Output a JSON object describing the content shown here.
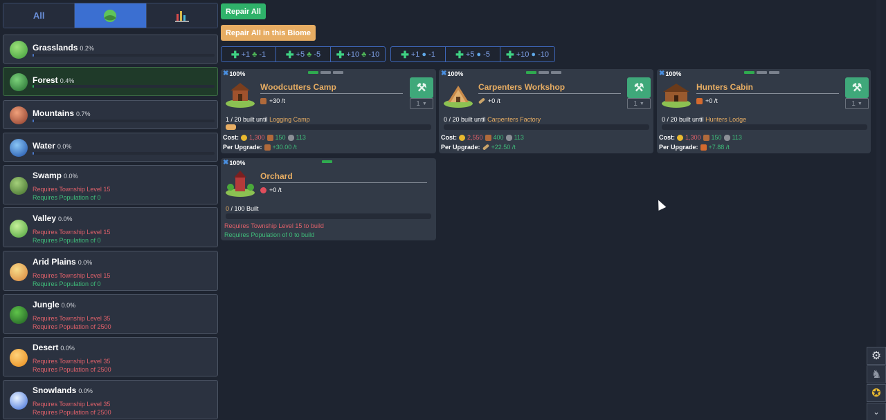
{
  "tabs": [
    {
      "label": "All"
    },
    {
      "label": "",
      "icon": "globe-icon"
    },
    {
      "label": "",
      "icon": "stats-chart-icon"
    }
  ],
  "biomes": [
    {
      "name": "Grasslands",
      "pct": "0.2%",
      "icon_color": "#5fc45a"
    },
    {
      "name": "Forest",
      "pct": "0.4%",
      "icon_color": "#3a9a45"
    },
    {
      "name": "Mountains",
      "pct": "0.7%",
      "icon_color": "#c86a4a"
    },
    {
      "name": "Water",
      "pct": "0.0%",
      "icon_color": "#3a7ad8"
    },
    {
      "name": "Swamp",
      "pct": "0.0%",
      "req_level": "Requires Township Level 15",
      "req_pop": "Requires Population of 0"
    },
    {
      "name": "Valley",
      "pct": "0.0%",
      "req_level": "Requires Township Level 15",
      "req_pop": "Requires Population of 0"
    },
    {
      "name": "Arid Plains",
      "pct": "0.0%",
      "req_level": "Requires Township Level 15",
      "req_pop": "Requires Population of 0"
    },
    {
      "name": "Jungle",
      "pct": "0.0%",
      "req_level": "Requires Township Level 35",
      "req_pop": "Requires Population of 2500"
    },
    {
      "name": "Desert",
      "pct": "0.0%",
      "req_level": "Requires Township Level 35",
      "req_pop": "Requires Population of 2500"
    },
    {
      "name": "Snowlands",
      "pct": "0.0%",
      "req_level": "Requires Township Level 35",
      "req_pop": "Requires Population of 2500"
    }
  ],
  "actions": {
    "repair_all": "Repair All",
    "repair_biome": "Repair All in this Biome"
  },
  "steps_wood": [
    "+1",
    "-1",
    "+5",
    "-5",
    "+10",
    "-10"
  ],
  "steps_water": [
    "+1",
    "-1",
    "+5",
    "-5",
    "+10",
    "-10"
  ],
  "buildings": [
    {
      "mastery": "100%",
      "title": "Woodcutters Camp",
      "prod": "+30 /t",
      "qty": "1",
      "built_count": "1",
      "built_total": "/ 20 built until",
      "next": "Logging Camp",
      "progress": 0.05,
      "cost_label": "Cost:",
      "cost": [
        "1,300",
        "150",
        "113"
      ],
      "upgrade_label": "Per Upgrade:",
      "per_upgrade": "+30.00 /t"
    },
    {
      "mastery": "100%",
      "title": "Carpenters Workshop",
      "prod": "+0 /t",
      "qty": "1",
      "built_count": "0",
      "built_total": "/ 20 built until",
      "next": "Carpenters Factory",
      "progress": 0,
      "cost_label": "Cost:",
      "cost": [
        "2,550",
        "400",
        "113"
      ],
      "upgrade_label": "Per Upgrade:",
      "per_upgrade": "+22.50 /t"
    },
    {
      "mastery": "100%",
      "title": "Hunters Cabin",
      "prod": "+0 /t",
      "qty": "1",
      "built_count": "0",
      "built_total": "/ 20 built until",
      "next": "Hunters Lodge",
      "progress": 0,
      "cost_label": "Cost:",
      "cost": [
        "1,300",
        "150",
        "113"
      ],
      "upgrade_label": "Per Upgrade:",
      "per_upgrade": "+7.88 /t"
    },
    {
      "mastery": "100%",
      "title": "Orchard",
      "prod": "+0 /t",
      "built_count": "0",
      "built_total": "/ 100 Built",
      "progress": 0,
      "req_level": "Requires Township Level 15 to build",
      "req_pop": "Requires Population of 0 to build"
    }
  ]
}
